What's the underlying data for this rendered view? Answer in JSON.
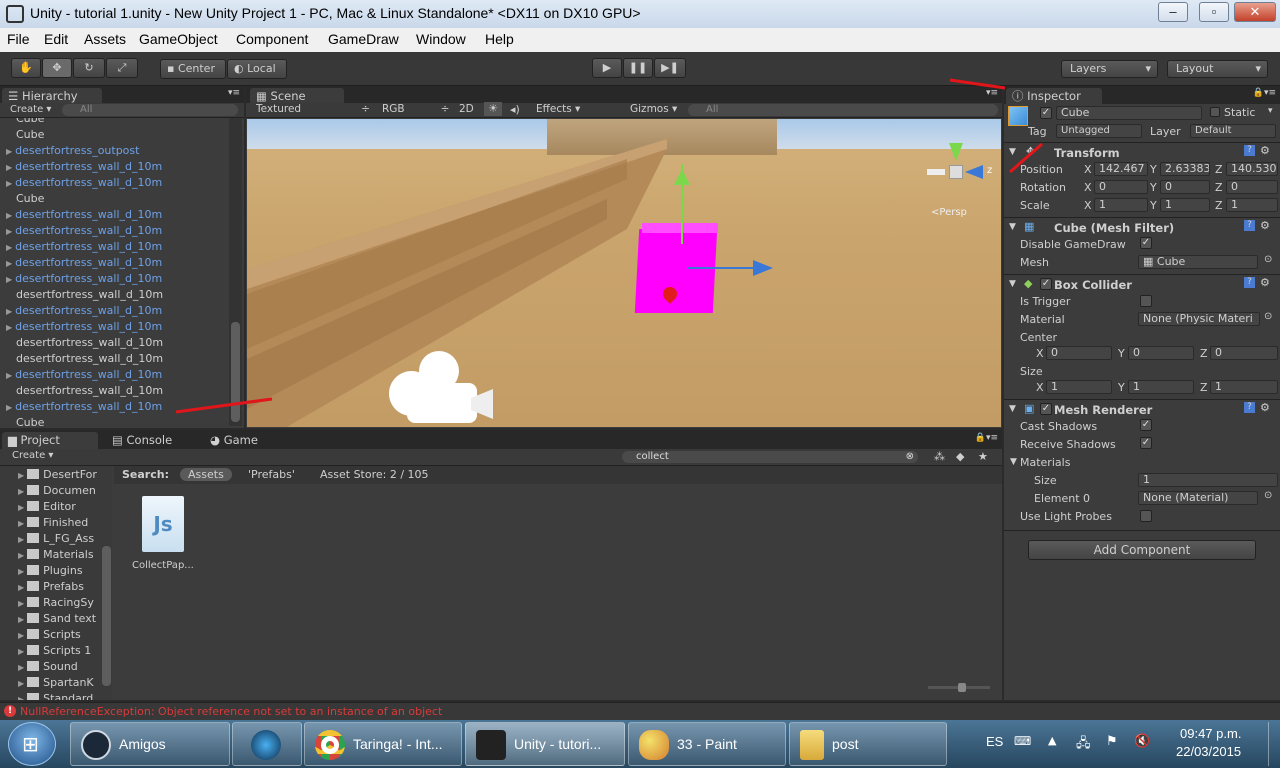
{
  "window": {
    "title": "Unity - tutorial 1.unity - New Unity Project 1 - PC, Mac & Linux Standalone* <DX11 on DX10 GPU>",
    "min": "–",
    "max": "▫",
    "close": "✕"
  },
  "menu": [
    "File",
    "Edit",
    "Assets",
    "GameObject",
    "Component",
    "GameDraw",
    "Window",
    "Help"
  ],
  "toolbar": {
    "center": "Center",
    "local": "Local",
    "layers": "Layers",
    "layout": "Layout"
  },
  "hierarchy": {
    "tab": "Hierarchy",
    "create": "Create",
    "search": "All",
    "items": [
      {
        "name": "Cube",
        "prefab": false,
        "expand": false
      },
      {
        "name": "Cube",
        "prefab": false,
        "expand": false
      },
      {
        "name": "desertfortress_outpost",
        "prefab": true,
        "expand": true
      },
      {
        "name": "desertfortress_wall_d_10m",
        "prefab": true,
        "expand": true
      },
      {
        "name": "desertfortress_wall_d_10m",
        "prefab": true,
        "expand": true
      },
      {
        "name": "Cube",
        "prefab": false,
        "expand": false
      },
      {
        "name": "desertfortress_wall_d_10m",
        "prefab": true,
        "expand": true
      },
      {
        "name": "desertfortress_wall_d_10m",
        "prefab": true,
        "expand": true
      },
      {
        "name": "desertfortress_wall_d_10m",
        "prefab": true,
        "expand": true
      },
      {
        "name": "desertfortress_wall_d_10m",
        "prefab": true,
        "expand": true
      },
      {
        "name": "desertfortress_wall_d_10m",
        "prefab": true,
        "expand": true
      },
      {
        "name": "desertfortress_wall_d_10m",
        "prefab": false,
        "expand": false
      },
      {
        "name": "desertfortress_wall_d_10m",
        "prefab": true,
        "expand": true
      },
      {
        "name": "desertfortress_wall_d_10m",
        "prefab": true,
        "expand": true
      },
      {
        "name": "desertfortress_wall_d_10m",
        "prefab": false,
        "expand": false
      },
      {
        "name": "desertfortress_wall_d_10m",
        "prefab": false,
        "expand": false
      },
      {
        "name": "desertfortress_wall_d_10m",
        "prefab": true,
        "expand": true
      },
      {
        "name": "desertfortress_wall_d_10m",
        "prefab": false,
        "expand": false
      },
      {
        "name": "desertfortress_wall_d_10m",
        "prefab": true,
        "expand": true
      },
      {
        "name": "Cube",
        "prefab": false,
        "expand": false
      }
    ]
  },
  "scene": {
    "tab": "Scene",
    "shading": "Textured",
    "render": "RGB",
    "mode2d": "2D",
    "effects": "Effects",
    "gizmos": "Gizmos",
    "search": "All",
    "persp": "Persp",
    "gizmo_z": "z"
  },
  "project": {
    "tabs": [
      "Project",
      "Console",
      "Game"
    ],
    "create": "Create",
    "search": "collect",
    "search_label": "Search:",
    "scope_assets": "Assets",
    "scope_prefabs": "'Prefabs'",
    "asset_store": "Asset Store: 2 / 105",
    "folders": [
      "DesertFor",
      "Documen",
      "Editor",
      "Finished",
      "L_FG_Ass",
      "Materials",
      "Plugins",
      "Prefabs",
      "RacingSy",
      "Sand text",
      "Scripts",
      "Scripts 1",
      "Sound",
      "SpartanK",
      "Standard"
    ],
    "file": {
      "name": "CollectPap...",
      "icon": "Js"
    }
  },
  "inspector": {
    "tab": "Inspector",
    "object_name": "Cube",
    "static": "Static",
    "tag_label": "Tag",
    "tag": "Untagged",
    "layer_label": "Layer",
    "layer": "Default",
    "transform": {
      "title": "Transform",
      "position_label": "Position",
      "rotation_label": "Rotation",
      "scale_label": "Scale",
      "position": {
        "x": "142.467",
        "y": "2.63383",
        "z": "140.530"
      },
      "rotation": {
        "x": "0",
        "y": "0",
        "z": "0"
      },
      "scale": {
        "x": "1",
        "y": "1",
        "z": "1"
      }
    },
    "mesh_filter": {
      "title": "Cube (Mesh Filter)",
      "disable_label": "Disable GameDraw",
      "mesh_label": "Mesh",
      "mesh": "Cube"
    },
    "box_collider": {
      "title": "Box Collider",
      "trigger_label": "Is Trigger",
      "material_label": "Material",
      "material": "None (Physic Materi",
      "center_label": "Center",
      "center": {
        "x": "0",
        "y": "0",
        "z": "0"
      },
      "size_label": "Size",
      "size": {
        "x": "1",
        "y": "1",
        "z": "1"
      }
    },
    "mesh_renderer": {
      "title": "Mesh Renderer",
      "cast_label": "Cast Shadows",
      "receive_label": "Receive Shadows",
      "materials_label": "Materials",
      "size_label": "Size",
      "size": "1",
      "element_label": "Element 0",
      "element": "None (Material)",
      "probes_label": "Use Light Probes"
    },
    "add_component": "Add Component"
  },
  "status": {
    "error": "NullReferenceException: Object reference not set to an instance of an object"
  },
  "taskbar": {
    "items": [
      "Amigos",
      "",
      "Taringa! - Int...",
      "Unity - tutori...",
      "33 - Paint",
      "post"
    ],
    "lang": "ES",
    "time": "09:47 p.m.",
    "date": "22/03/2015"
  },
  "colors": {
    "prefab": "#6ea1e6",
    "cube": "#ff00ff",
    "error": "#d93a3a",
    "accent": "#3e6fb5"
  }
}
